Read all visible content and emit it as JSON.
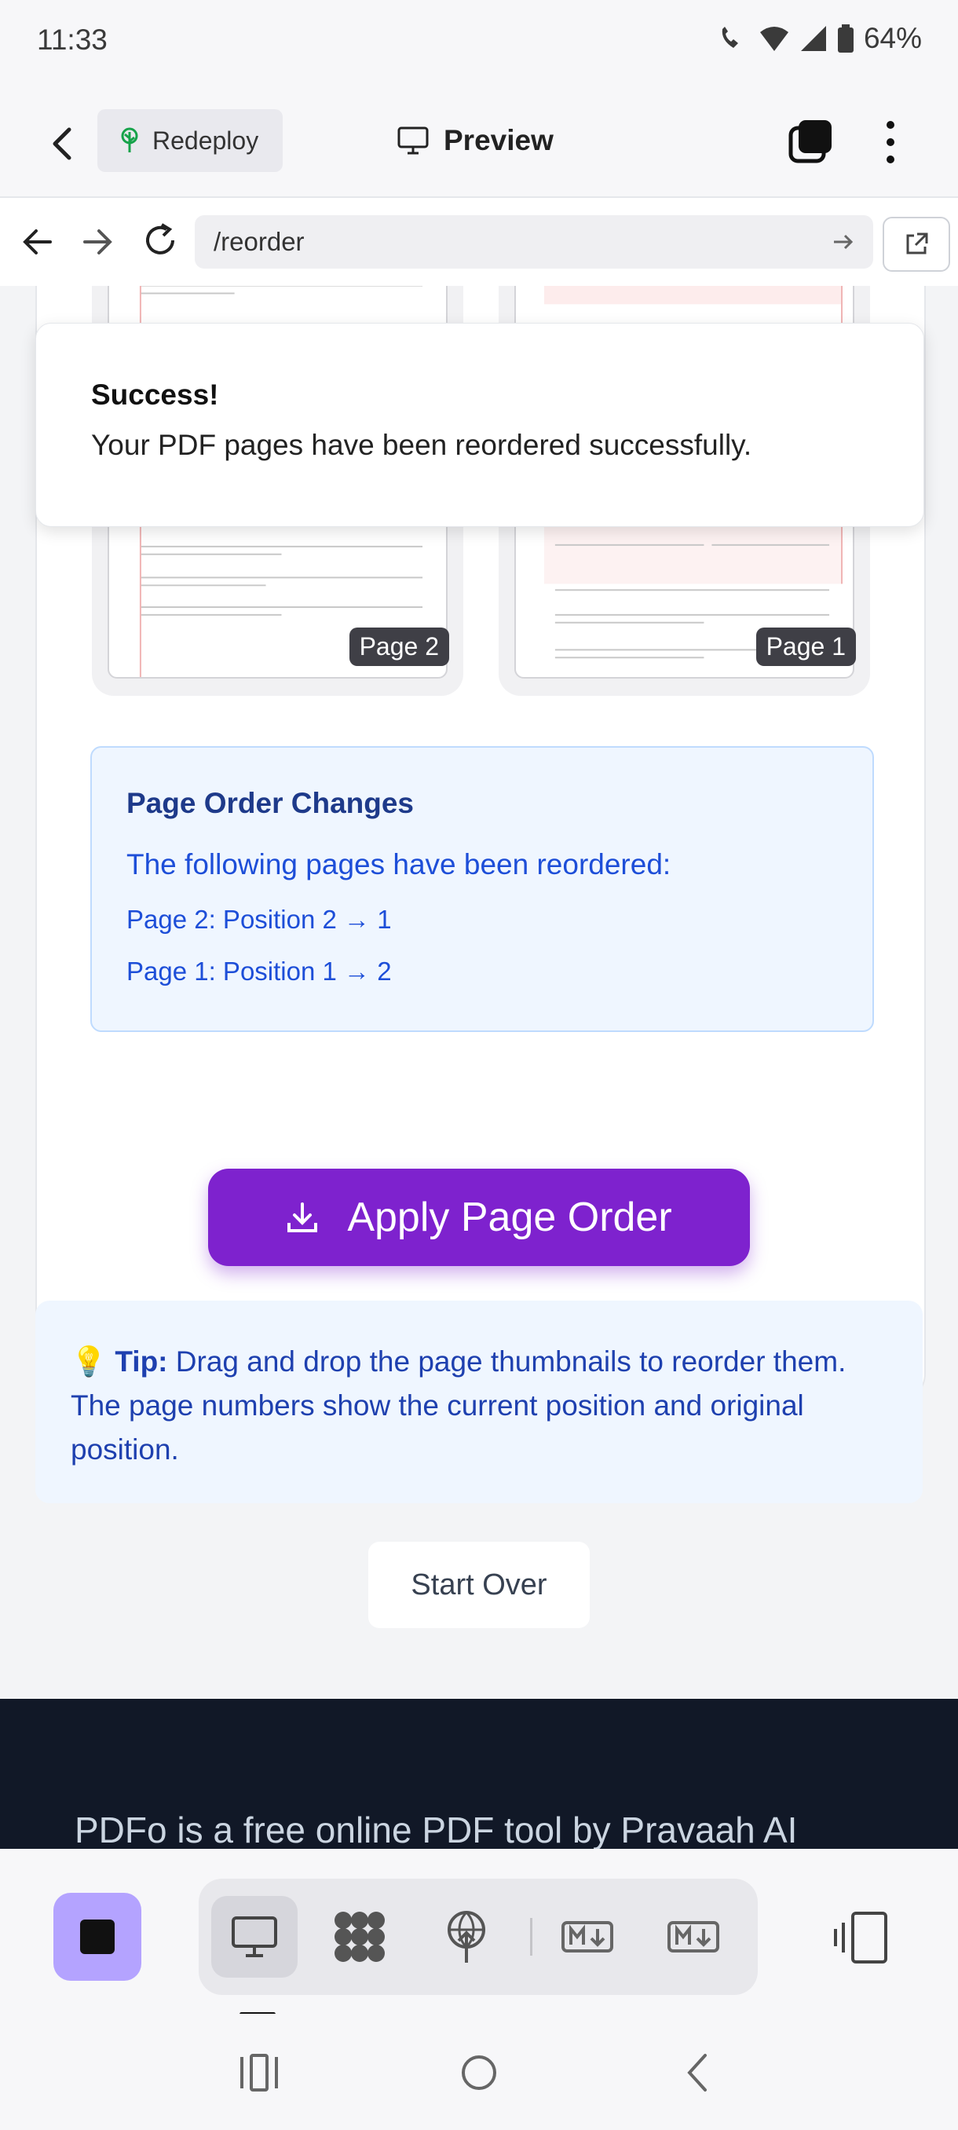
{
  "status_bar": {
    "time": "11:33",
    "battery": "64%"
  },
  "app_bar": {
    "redeploy_label": "Redeploy",
    "preview_label": "Preview"
  },
  "browser": {
    "url": "/reorder"
  },
  "toast": {
    "title": "Success!",
    "message": "Your PDF pages have been reordered successfully."
  },
  "thumbnails": [
    {
      "badge": "Page 2"
    },
    {
      "badge": "Page 1"
    }
  ],
  "order_changes": {
    "title": "Page Order Changes",
    "subtitle": "The following pages have been reordered:",
    "lines": [
      "Page 2: Position 2 → 1",
      "Page 1: Position 1 → 2"
    ]
  },
  "apply_button": {
    "label": "Apply Page Order"
  },
  "tip": {
    "emoji": "💡",
    "label": "Tip:",
    "text": "Drag and drop the page thumbnails to reorder them. The page numbers show the current position and original position."
  },
  "start_over": {
    "label": "Start Over"
  },
  "footer": {
    "text": "PDFo is a free online PDF tool by Pravaah AI"
  },
  "colors": {
    "accent": "#7e22ce",
    "tip_bg": "#eff6ff",
    "tip_text": "#1e40af",
    "footer_bg": "#111827",
    "stop_btn": "#b4a3ff"
  },
  "icons": {
    "back": "chevron-left-icon",
    "redeploy": "tree-icon",
    "preview": "monitor-icon",
    "tabs": "tabs-icon",
    "more": "more-vertical-icon",
    "nav_back": "arrow-left-icon",
    "nav_forward": "arrow-right-icon",
    "reload": "reload-icon",
    "open_external": "external-link-icon",
    "apply": "download-icon",
    "toolbar": [
      "stop-icon",
      "desktop-icon",
      "dots-grid-icon",
      "globe-pin-icon",
      "markdown-icon",
      "markdown-icon",
      "split-view-icon"
    ]
  }
}
